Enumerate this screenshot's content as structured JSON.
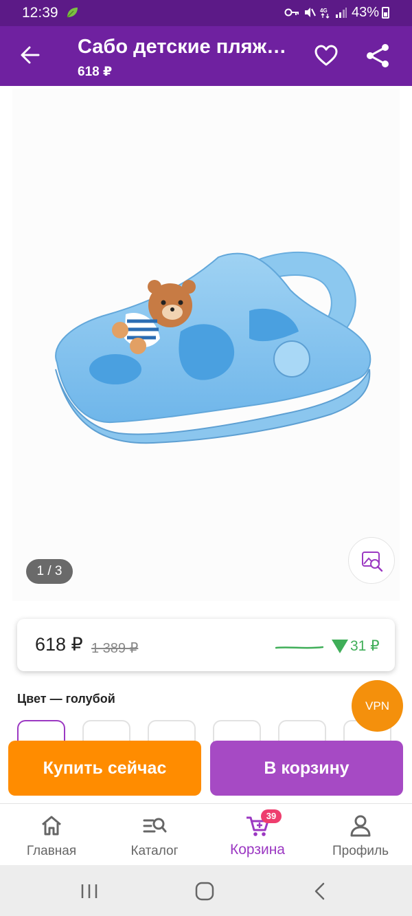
{
  "status_bar": {
    "time": "12:39",
    "battery": "43%"
  },
  "header": {
    "title": "Сабо детские пляжные",
    "price": "618 ₽"
  },
  "gallery": {
    "pager": "1 / 3"
  },
  "price_block": {
    "current": "618 ₽",
    "old": "1 389 ₽",
    "drop": "31 ₽"
  },
  "color": {
    "label": "Цвет — голубой",
    "swatch_count": 6,
    "selected_index": 0
  },
  "vpn": {
    "label": "VPN"
  },
  "actions": {
    "buy_now": "Купить сейчас",
    "add_to_cart": "В корзину"
  },
  "bottom_nav": {
    "items": [
      {
        "label": "Главная",
        "icon": "home-icon"
      },
      {
        "label": "Каталог",
        "icon": "catalog-search-icon"
      },
      {
        "label": "Корзина",
        "icon": "cart-icon",
        "badge": "39",
        "active": true
      },
      {
        "label": "Профиль",
        "icon": "profile-icon"
      }
    ]
  },
  "colors": {
    "header": "#6f21a0",
    "status_bar": "#5c1a87",
    "buy": "#ff8c00",
    "cart": "#a64ac4",
    "accent": "#9b38c2",
    "price_drop": "#3fae58"
  }
}
